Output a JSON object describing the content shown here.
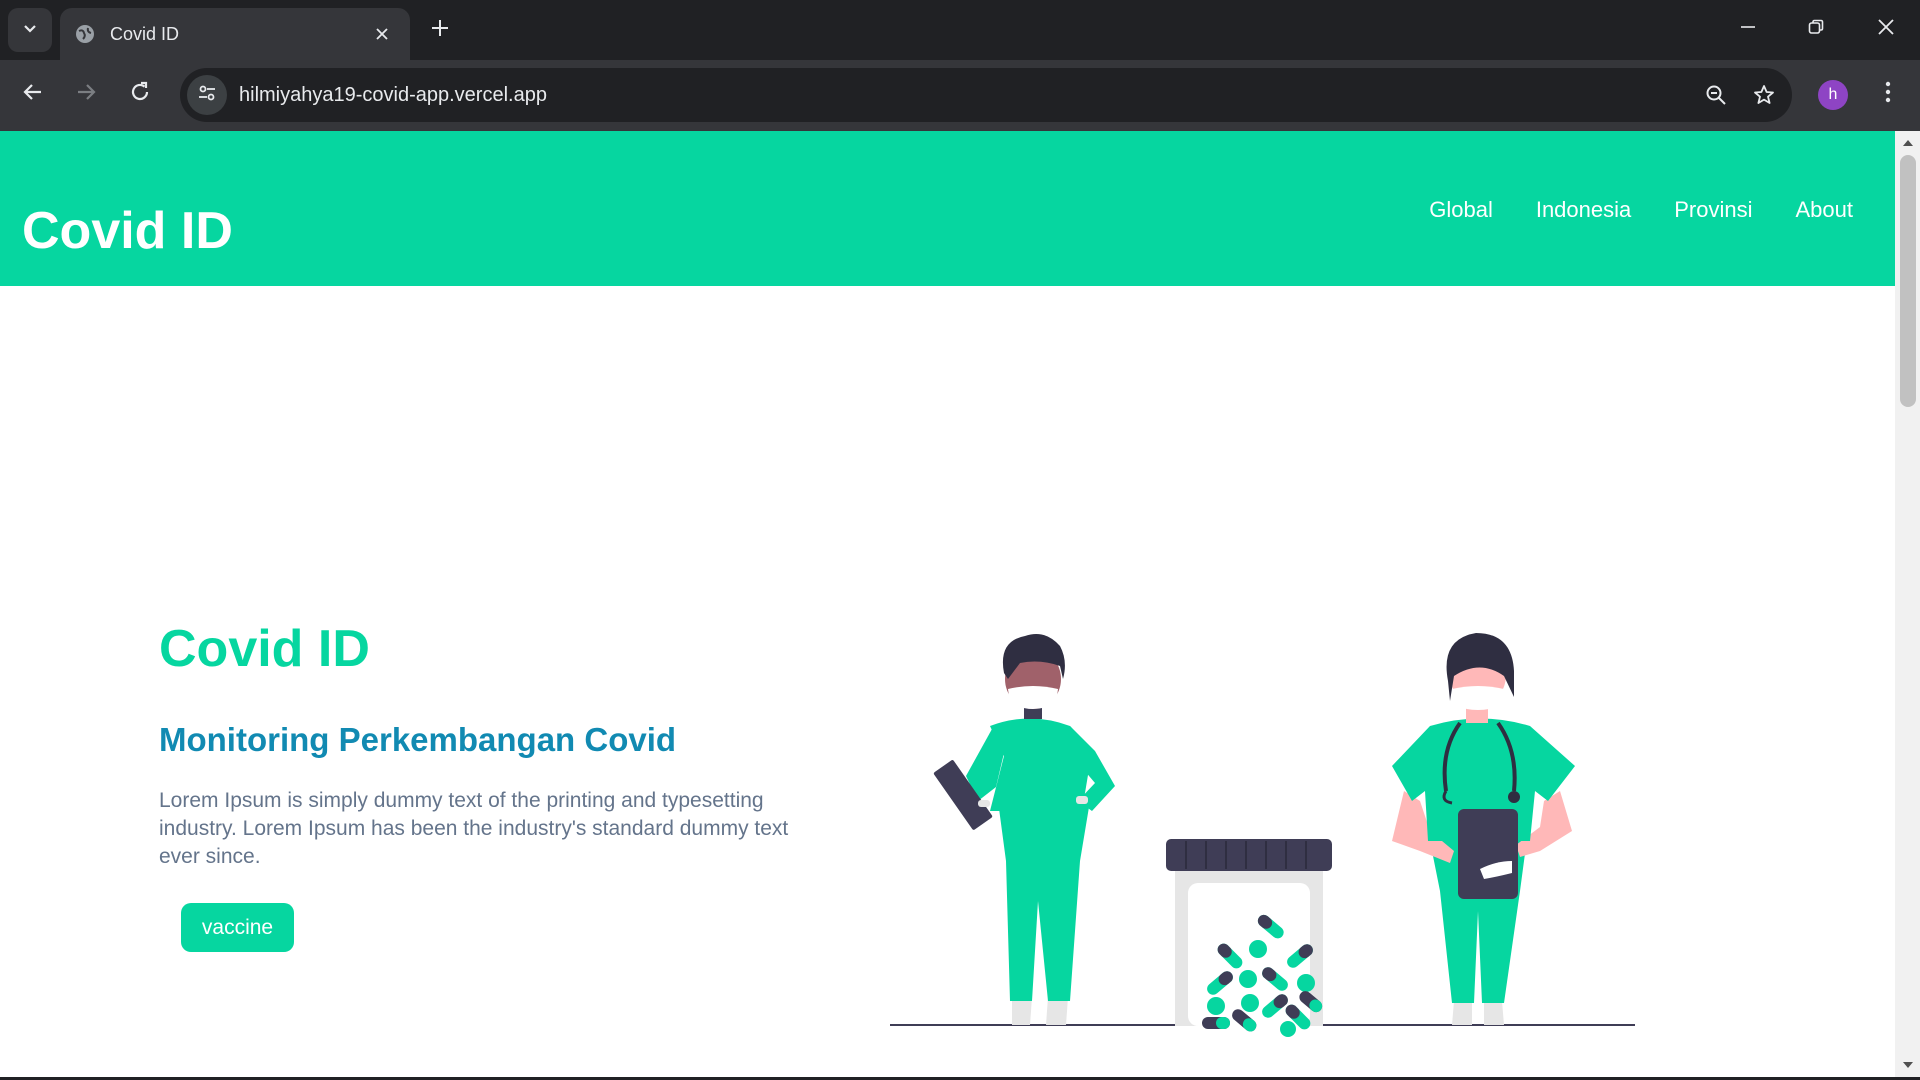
{
  "browser": {
    "tab_title": "Covid ID",
    "url": "hilmiyahya19-covid-app.vercel.app",
    "profile_initial": "h",
    "icons": [
      "chevron-down-icon",
      "globe-icon",
      "close-icon",
      "plus-icon",
      "minimize-icon",
      "restore-icon",
      "back-icon",
      "forward-icon",
      "reload-icon",
      "site-settings-icon",
      "zoom-icon",
      "star-icon",
      "kebab-menu-icon"
    ]
  },
  "site": {
    "brand": "Covid ID",
    "nav": [
      "Global",
      "Indonesia",
      "Provinsi",
      "About"
    ],
    "hero": {
      "title": "Covid ID",
      "subtitle": "Monitoring Perkembangan Covid",
      "text": "Lorem Ipsum is simply dummy text of the printing and typesetting industry. Lorem Ipsum has been the industry's standard dummy text ever since.",
      "button": "vaccine"
    },
    "colors": {
      "primary": "#06d6a0",
      "secondary": "#118ab2",
      "text": "#64748b",
      "dark": "#3f3d56"
    }
  }
}
